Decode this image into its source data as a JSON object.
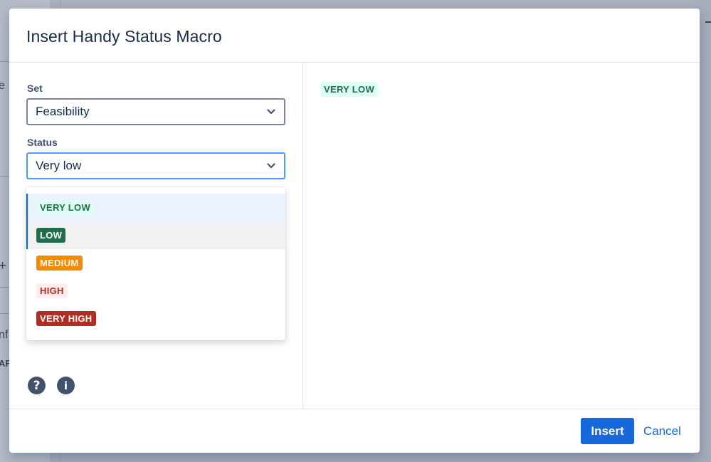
{
  "background": {
    "fragments": [
      "e",
      "+",
      "nf",
      "AF"
    ]
  },
  "dialog": {
    "title": "Insert Handy Status Macro"
  },
  "form": {
    "set_label": "Set",
    "set_value": "Feasibility",
    "status_label": "Status",
    "status_value": "Very low"
  },
  "dropdown": {
    "options": [
      {
        "label": "VERY LOW",
        "state": "selected",
        "fg": "#216e4e",
        "bg": "#dcfff1"
      },
      {
        "label": "LOW",
        "state": "hovered",
        "fg": "#ffffff",
        "bg": "#216e4e"
      },
      {
        "label": "MEDIUM",
        "state": "",
        "fg": "#ffffff",
        "bg": "#f38a00"
      },
      {
        "label": "HIGH",
        "state": "",
        "fg": "#ae2e24",
        "bg": "#ffeceb"
      },
      {
        "label": "VERY HIGH",
        "state": "",
        "fg": "#ffffff",
        "bg": "#ae2e24"
      }
    ]
  },
  "icons": {
    "help": "question-circle-icon",
    "info": "info-circle-icon",
    "help_glyph": "?",
    "info_glyph": "i"
  },
  "preview": {
    "label": "VERY LOW",
    "fg": "#216e4e",
    "bg": "#dcfff1"
  },
  "footer": {
    "insert_label": "Insert",
    "cancel_label": "Cancel"
  }
}
